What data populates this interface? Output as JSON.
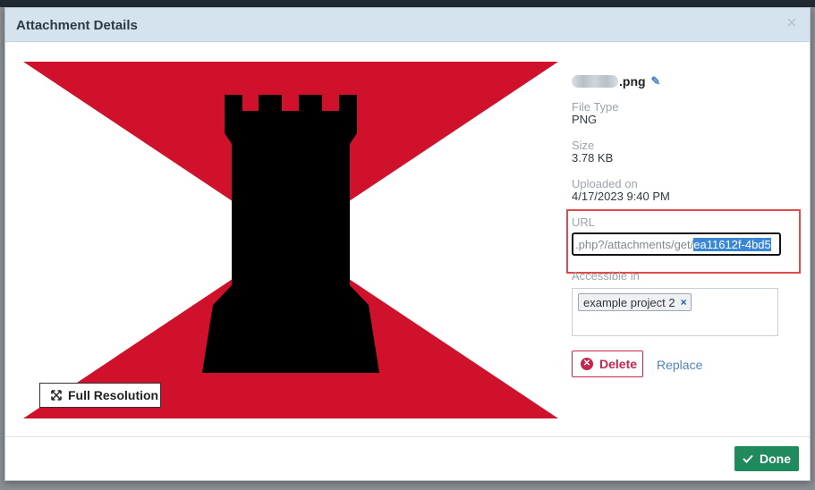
{
  "dialog": {
    "title": "Attachment Details",
    "close_glyph": "×"
  },
  "preview": {
    "full_resolution_label": "Full Resolution"
  },
  "details": {
    "file_name_suffix": ".png",
    "file_type_label": "File Type",
    "file_type_value": "PNG",
    "size_label": "Size",
    "size_value": "3.78 KB",
    "uploaded_label": "Uploaded on",
    "uploaded_value": "4/17/2023 9:40 PM",
    "url_label": "URL",
    "url_prefix": ".php?/attachments/get/",
    "url_selected": "ea11612f-4bd5",
    "accessible_label": "Accessible in",
    "tags": [
      "example project 2"
    ],
    "tag_remove_glyph": "×"
  },
  "actions": {
    "delete_label": "Delete",
    "replace_label": "Replace",
    "done_label": "Done"
  },
  "colors": {
    "flag_red": "#d0112b",
    "tower_black": "#000000",
    "done_green": "#1f8a5c",
    "delete_red": "#c7254e",
    "highlight_red": "#e04a4a",
    "selection_blue": "#3a87d6"
  }
}
